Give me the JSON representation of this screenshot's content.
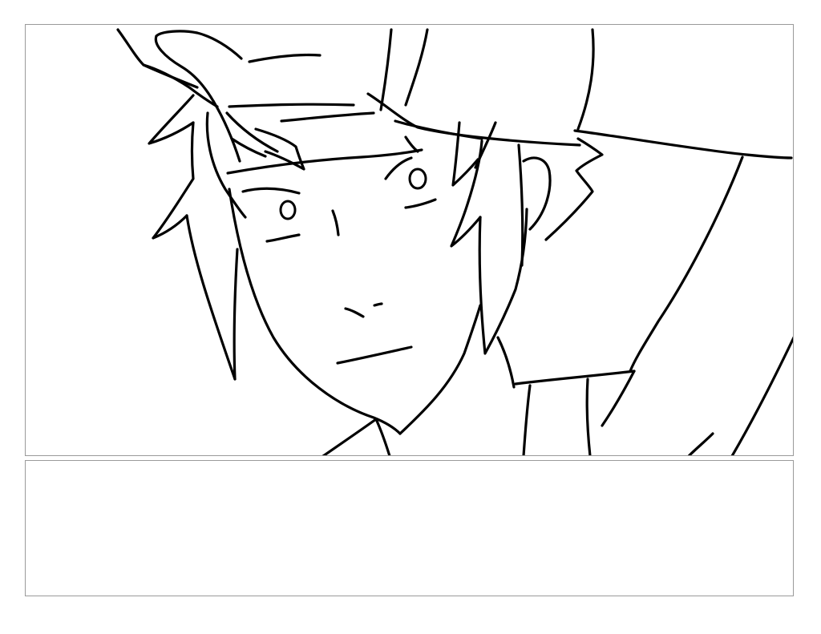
{
  "storyboard": {
    "panel": {
      "image": "character-sketch",
      "ink_color": "#000000"
    },
    "notes": {
      "text": ""
    }
  }
}
